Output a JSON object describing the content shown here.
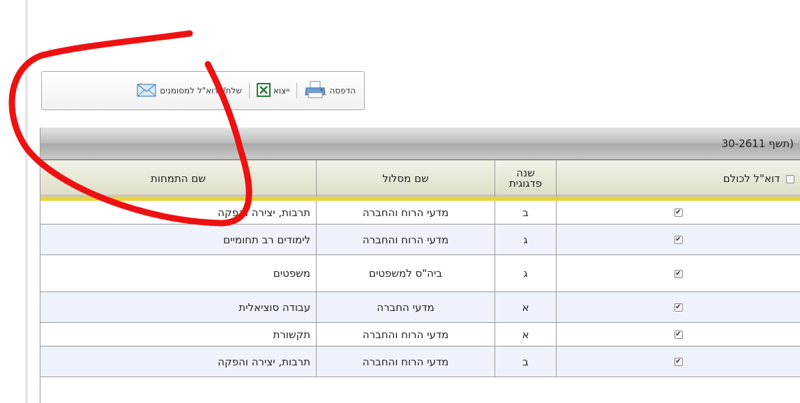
{
  "toolbar": {
    "print_label": "הדפסה",
    "export_label": "ייצוא",
    "email_label": "שלח/י דוא\"ל למסומנים"
  },
  "grid": {
    "caption": "30-2611   תשף)",
    "columns": {
      "email_all": "דוא\"ל לכולם",
      "year": "שנה\nפדגוגית",
      "track": "שם מסלול",
      "major": "שם התמחות"
    },
    "checkmark": "✔",
    "rows": [
      {
        "checked": true,
        "year": "ב",
        "track": "מדעי הרוח והחברה",
        "major": "תרבות, יצירה והפקה"
      },
      {
        "checked": true,
        "year": "ג",
        "track": "מדעי הרוח והחברה",
        "major": "לימודים רב תחומיים"
      },
      {
        "checked": true,
        "year": "ג",
        "track": "ביה\"ס למשפטים",
        "major": "משפטים"
      },
      {
        "checked": true,
        "year": "א",
        "track": "מדעי החברה",
        "major": "עבודה סוציאלית"
      },
      {
        "checked": true,
        "year": "א",
        "track": "מדעי הרוח והחברה",
        "major": "תקשורת"
      },
      {
        "checked": true,
        "year": "ב",
        "track": "מדעי הרוח והחברה",
        "major": "תרבות, יצירה והפקה"
      }
    ]
  },
  "colors": {
    "header_underline": "#e9d23a",
    "alt_row": "#eef3fb",
    "annotation": "#ee1111"
  }
}
